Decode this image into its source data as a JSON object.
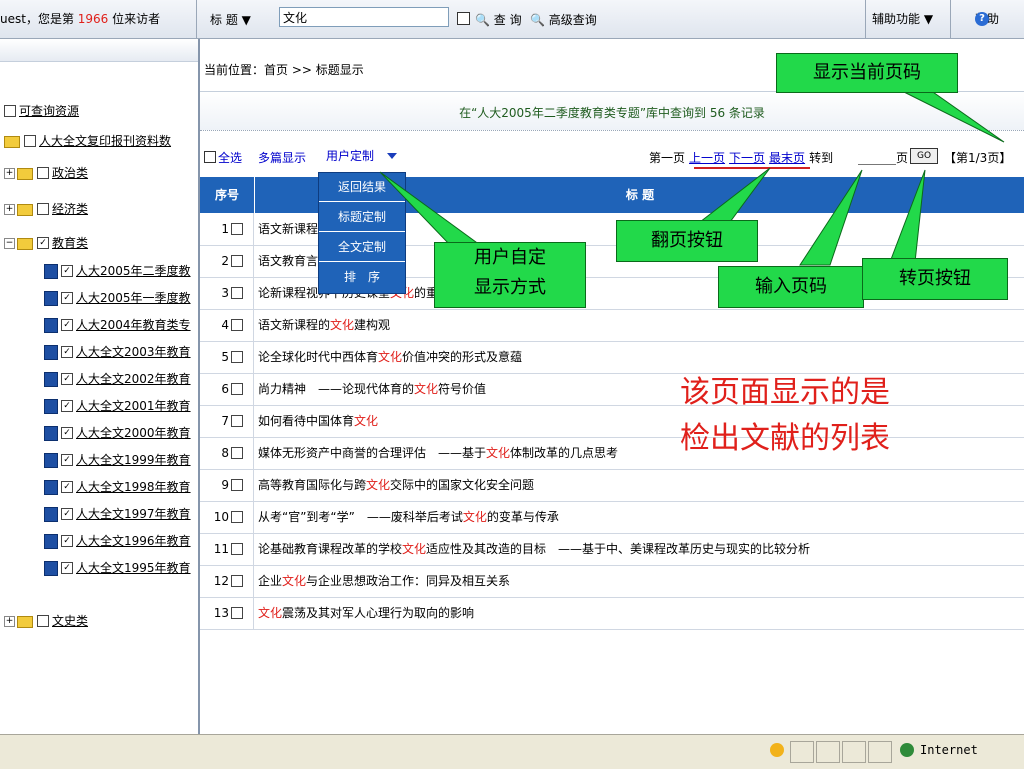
{
  "topbar": {
    "visitor_prefix": "uest，您是第",
    "visitor_count": "1966",
    "visitor_suffix": "位来访者",
    "field_label": "标 题",
    "field_caret": "▼",
    "search_value": "文化",
    "search_label": "查 询",
    "advanced_label": "高级查询",
    "assist_label": "辅助功能 ▼",
    "help_label": "帮助"
  },
  "sidebar": {
    "root": "可查询资源",
    "items": [
      {
        "label": "人大全文复印报刊资料数"
      },
      {
        "label": "政治类"
      },
      {
        "label": "经济类"
      },
      {
        "label": "教育类"
      },
      {
        "label": "人大2005年二季度教"
      },
      {
        "label": "人大2005年一季度教"
      },
      {
        "label": "人大2004年教育类专"
      },
      {
        "label": "人大全文2003年教育"
      },
      {
        "label": "人大全文2002年教育"
      },
      {
        "label": "人大全文2001年教育"
      },
      {
        "label": "人大全文2000年教育"
      },
      {
        "label": "人大全文1999年教育"
      },
      {
        "label": "人大全文1998年教育"
      },
      {
        "label": "人大全文1997年教育"
      },
      {
        "label": "人大全文1996年教育"
      },
      {
        "label": "人大全文1995年教育"
      },
      {
        "label": "文史类"
      }
    ]
  },
  "main": {
    "breadcrumb": "当前位置：首页 >> 标题显示",
    "summary": "在“人大2005年二季度教育类专题”库中查询到 56 条记录",
    "select_all": "全选",
    "multi_display": "多篇显示",
    "custom_label": "用户定制",
    "pager": {
      "first": "第一页",
      "prev": "上一页",
      "next": "下一页",
      "last": "最末页",
      "goto": "转到",
      "page_unit": "页",
      "go_button": "GO",
      "info": "【第1/3页】"
    },
    "table_headers": [
      "序号",
      "标 题"
    ],
    "rows": [
      {
        "num": "1",
        "pre": "语文新课程",
        "hl": "",
        "post": ""
      },
      {
        "num": "2",
        "pre": "语文教育言",
        "hl": "",
        "post": ""
      },
      {
        "num": "3",
        "pre": "论新课程视界下历史课堂",
        "hl": "文化",
        "post": "的重塑"
      },
      {
        "num": "4",
        "pre": "语文新课程的",
        "hl": "文化",
        "post": "建构观"
      },
      {
        "num": "5",
        "pre": "论全球化时代中西体育",
        "hl": "文化",
        "post": "价值冲突的形式及意蕴"
      },
      {
        "num": "6",
        "pre": "尚力精神　——论现代体育的",
        "hl": "文化",
        "post": "符号价值"
      },
      {
        "num": "7",
        "pre": "如何看待中国体育",
        "hl": "文化",
        "post": ""
      },
      {
        "num": "8",
        "pre": "媒体无形资产中商誉的合理评估　——基于",
        "hl": "文化",
        "post": "体制改革的几点思考"
      },
      {
        "num": "9",
        "pre": "高等教育国际化与跨",
        "hl": "文化",
        "post": "交际中的国家文化安全问题"
      },
      {
        "num": "10",
        "pre": "从考“官”到考“学”　——废科举后考试",
        "hl": "文化",
        "post": "的变革与传承"
      },
      {
        "num": "11",
        "pre": "论基础教育课程改革的学校",
        "hl": "文化",
        "post": "适应性及其改造的目标　——基于中、美课程改革历史与现实的比较分析"
      },
      {
        "num": "12",
        "pre": "企业",
        "hl": "文化",
        "post": "与企业思想政治工作：同异及相互关系"
      },
      {
        "num": "13",
        "pre": "",
        "hl": "文化",
        "post": "震荡及其对军人心理行为取向的影响"
      }
    ],
    "dropdown": [
      "返回结果",
      "标题定制",
      "全文定制",
      "排　序"
    ]
  },
  "annotations": {
    "current_page": "显示当前页码",
    "page_buttons": "翻页按钮",
    "custom_display": "用户自定\n显示方式",
    "input_page": "输入页码",
    "go_button": "转页按钮",
    "list_note_1": "该页面显示的是",
    "list_note_2": "检出文献的列表",
    "callout_color": "#22d94a"
  },
  "statusbar": {
    "zone": "Internet"
  }
}
